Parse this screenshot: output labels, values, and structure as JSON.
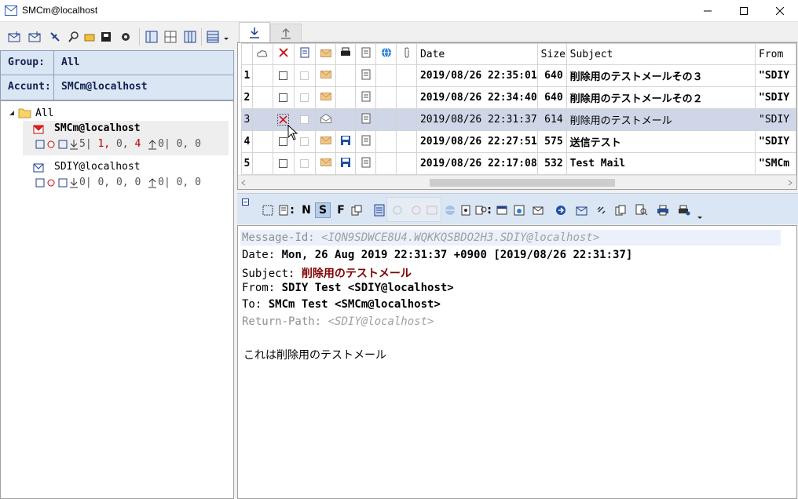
{
  "window": {
    "title": "SMCm@localhost"
  },
  "left": {
    "group_label": "Group:",
    "group_value": "All",
    "account_label": "Accunt:",
    "account_value": "SMCm@localhost",
    "tree": {
      "root_label": "All",
      "accounts": [
        {
          "name": "SMCm@localhost",
          "dl_count": "5",
          "sep1": "|",
          "n1": "1,",
          "n2": "0,",
          "n3": "4",
          "ul_count": "0",
          "rest": "| 0, 0"
        },
        {
          "name": "SDIY@localhost",
          "dl_count": "0",
          "sep1": "|",
          "n1": "0,",
          "n2": "0,",
          "n3": "0",
          "ul_count": "0",
          "rest": "| 0, 0"
        }
      ]
    }
  },
  "list": {
    "headers": {
      "date": "Date",
      "size": "Size",
      "subject": "Subject",
      "from": "From"
    },
    "rows": [
      {
        "n": "1",
        "date": "2019/08/26 22:35:01",
        "size": "640",
        "subject": "削除用のテストメールその３",
        "from": "\"SDIY"
      },
      {
        "n": "2",
        "date": "2019/08/26 22:34:40",
        "size": "640",
        "subject": "削除用のテストメールその２",
        "from": "\"SDIY"
      },
      {
        "n": "3",
        "date": "2019/08/26 22:31:37",
        "size": "614",
        "subject": "削除用のテストメール",
        "from": "\"SDIY"
      },
      {
        "n": "4",
        "date": "2019/08/26 22:27:51",
        "size": "575",
        "subject": "送信テスト",
        "from": "\"SDIY"
      },
      {
        "n": "5",
        "date": "2019/08/26 22:17:08",
        "size": "532",
        "subject": "Test Mail",
        "from": "\"SMCm"
      }
    ]
  },
  "preview_toolbar": {
    "n": "N",
    "s": "S",
    "f": "F"
  },
  "preview": {
    "message_id_key": "Message-Id:",
    "message_id": "<IQN9SDWCE8U4.WQKKQSBDO2H3.SDIY@localhost>",
    "date_key": "Date:",
    "date": "Mon, 26 Aug 2019 22:31:37 +0900 [2019/08/26 22:31:37]",
    "subject_key": "Subject:",
    "subject": "削除用のテストメール",
    "from_key": "From:",
    "from": "SDIY Test <SDIY@localhost>",
    "to_key": "To:",
    "to": "SMCm Test <SMCm@localhost>",
    "return_path_key": "Return-Path:",
    "return_path": "<SDIY@localhost>",
    "body": "これは削除用のテストメール"
  },
  "colors": {
    "selected_row": "#cfd6e8",
    "panel_blue": "#dbe6f4",
    "subject_red": "#800000",
    "count_red": "#c00000"
  }
}
